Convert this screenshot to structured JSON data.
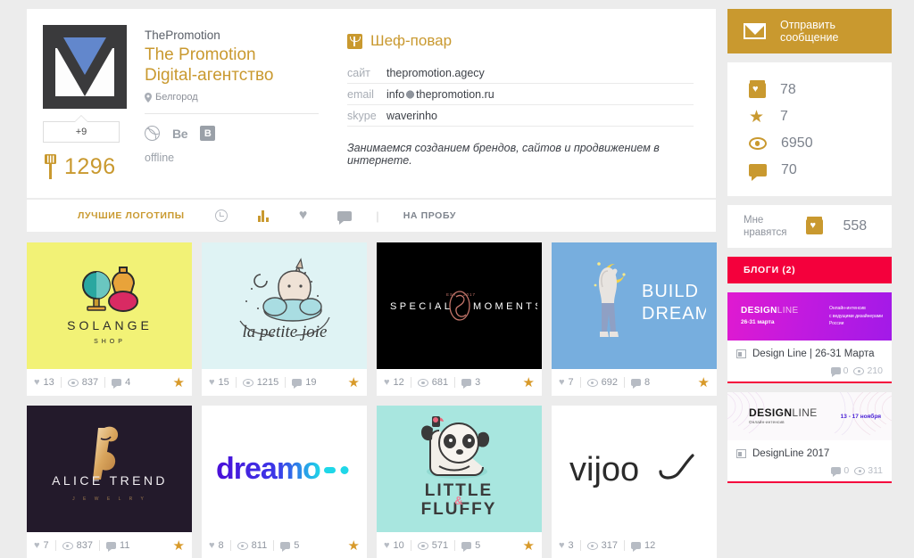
{
  "profile": {
    "username": "ThePromotion",
    "display_name_line1": "The Promotion",
    "display_name_line2": "Digital-агентство",
    "city": "Белгород",
    "extra_badge": "+9",
    "rank_value": "1296",
    "status": "offline",
    "social": {
      "dribbble": "dribbble-icon",
      "behance": "Be",
      "vk": "В"
    },
    "job_title": "Шеф-повар",
    "contacts": [
      {
        "key": "сайт",
        "value": "thepromotion.agecy"
      },
      {
        "key": "email",
        "value_before": "info",
        "value_after": "thepromotion.ru"
      },
      {
        "key": "skype",
        "value": "waverinho"
      }
    ],
    "bio": "Занимаемся созданием брендов, сайтов и продвижением в интернете."
  },
  "tabs": [
    {
      "label": "ЛУЧШИЕ ЛОГОТИПЫ",
      "type": "text",
      "active": true
    },
    {
      "label": "clock-icon",
      "type": "icon"
    },
    {
      "label": "bars-icon",
      "type": "icon"
    },
    {
      "label": "heart-icon",
      "type": "icon"
    },
    {
      "label": "comment-icon",
      "type": "icon"
    },
    {
      "label": "НА ПРОБУ",
      "type": "text",
      "active": false
    }
  ],
  "works": [
    {
      "name": "SOLANGE SHOP",
      "bg": "#f2f276",
      "likes": "13",
      "views": "837",
      "comments": "4",
      "starred": true
    },
    {
      "name": "la petite joie",
      "bg": "#dff3f4",
      "likes": "15",
      "views": "1215",
      "comments": "19",
      "starred": true
    },
    {
      "name": "SPECIAL MOMENTS",
      "bg": "#000000",
      "likes": "12",
      "views": "681",
      "comments": "3",
      "starred": true
    },
    {
      "name": "BUILD DREAM",
      "bg": "#77aede",
      "likes": "7",
      "views": "692",
      "comments": "8",
      "starred": true
    },
    {
      "name": "ALICE TREND JEWELRY",
      "bg": "#231a2b",
      "likes": "7",
      "views": "837",
      "comments": "11",
      "starred": true
    },
    {
      "name": "dreamo",
      "bg": "#ffffff",
      "likes": "8",
      "views": "811",
      "comments": "5",
      "starred": true
    },
    {
      "name": "LITTLE & FLUFFY",
      "bg": "#a8e6df",
      "likes": "10",
      "views": "571",
      "comments": "5",
      "starred": true
    },
    {
      "name": "vijoo",
      "bg": "#ffffff",
      "likes": "3",
      "views": "317",
      "comments": "12",
      "starred": false
    }
  ],
  "sidebar": {
    "message_button": "Отправить сообщение",
    "stats": [
      {
        "icon": "jar-heart-icon",
        "value": "78"
      },
      {
        "icon": "star-icon",
        "value": "7"
      },
      {
        "icon": "eye-icon",
        "value": "6950"
      },
      {
        "icon": "comment-icon",
        "value": "70"
      }
    ],
    "likes_label": "Мне\nнравятся",
    "likes_value": "558",
    "blogs_header": "БЛОГИ (2)",
    "blogs": [
      {
        "banner_logo_bold": "DESIGN",
        "banner_logo_light": "LINE",
        "banner_date": "26-31 марта",
        "banner_right": "Онлайн-интенсив\nс ведущими дизайнерами\nРоссии",
        "title": "Design Line | 26-31 Марта",
        "comments": "0",
        "views": "210"
      },
      {
        "banner_logo_bold": "DESIGN",
        "banner_logo_light": "LINE",
        "banner_sub": "Онлайн-интенсив",
        "banner_date2": "13 - 17 ноября",
        "title": "DesignLine 2017",
        "comments": "0",
        "views": "311"
      }
    ]
  },
  "colors": {
    "accent_gold": "#c9992f",
    "blog_red": "#f4003c",
    "text_dark": "#3d4148",
    "text_muted": "#9096a0"
  }
}
